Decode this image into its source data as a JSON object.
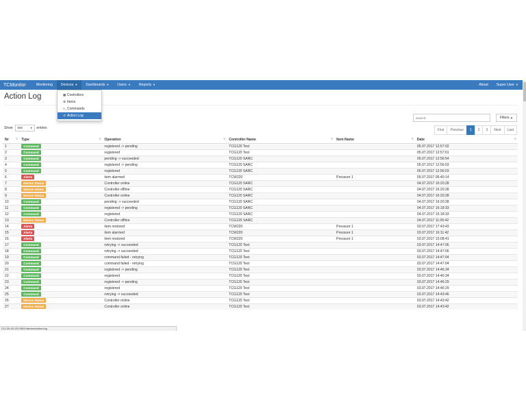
{
  "navbar": {
    "brand": "TCMonitor",
    "items": [
      {
        "label": "Monitoring",
        "caret": false
      },
      {
        "label": "Devices",
        "caret": true
      },
      {
        "label": "Dashboards",
        "caret": true
      },
      {
        "label": "Users",
        "caret": true
      },
      {
        "label": "Reports",
        "caret": true
      }
    ],
    "right": [
      {
        "label": "About",
        "caret": false
      },
      {
        "label": "Super User",
        "caret": true
      }
    ]
  },
  "devices_menu": [
    {
      "label": "Controllers",
      "icon": "controllers-icon",
      "glyph": "▦"
    },
    {
      "label": "Items",
      "icon": "gear-icon",
      "glyph": "⚙"
    },
    {
      "label": "Commands",
      "icon": "terminal-icon",
      "glyph": ">_"
    },
    {
      "label": "Action Log",
      "icon": "history-icon",
      "glyph": "↺"
    }
  ],
  "page": {
    "title": "Action Log"
  },
  "search": {
    "placeholder": "Search:"
  },
  "filters": {
    "label": "Filters"
  },
  "show": {
    "prefix": "Show",
    "value": "500",
    "suffix": "entries"
  },
  "pagination": [
    "First",
    "Previous",
    "1",
    "2",
    "3",
    "Next",
    "Last"
  ],
  "table": {
    "columns": [
      "Nr",
      "Type",
      "Operation",
      "Controller Name",
      "Item Name",
      "Date"
    ],
    "rows": [
      [
        "1",
        "Command",
        "registered -> pending",
        "TCG120 Test",
        "",
        "05.07.2017 12:57:02"
      ],
      [
        "2",
        "Command",
        "registered",
        "TCG120 Test",
        "",
        "05.07.2017 12:57:01"
      ],
      [
        "3",
        "Command",
        "pending -> succeeded",
        "TCG120 SARC",
        "",
        "05.07.2017 12:56:54"
      ],
      [
        "4",
        "Command",
        "registered -> pending",
        "TCG120 SARC",
        "",
        "05.07.2017 12:56:03"
      ],
      [
        "5",
        "Command",
        "registered",
        "TCG120 SARC",
        "",
        "05.07.2017 12:56:03"
      ],
      [
        "6",
        "Alerts",
        "item alarmed",
        "TCW220",
        "Pressure 1",
        "05.07.2017 06:40:14"
      ],
      [
        "7",
        "Device Status",
        "Controller online",
        "TCG120 SARC",
        "",
        "04.07.2017 16:20:28"
      ],
      [
        "8",
        "Device Status",
        "Controller offline",
        "TCG120 SARC",
        "",
        "04.07.2017 16:20:28"
      ],
      [
        "9",
        "Device Status",
        "Controller online",
        "TCG120 SARC",
        "",
        "04.07.2017 16:20:28"
      ],
      [
        "10",
        "Command",
        "pending -> succeeded",
        "TCG120 SARC",
        "",
        "04.07.2017 16:20:28"
      ],
      [
        "11",
        "Command",
        "registered -> pending",
        "TCG120 SARC",
        "",
        "04.07.2017 16:18:33"
      ],
      [
        "12",
        "Command",
        "registered",
        "TCG120 SARC",
        "",
        "04.07.2017 16:18:33"
      ],
      [
        "13",
        "Device Status",
        "Controller offline",
        "TCG120 SARC",
        "",
        "04.07.2017 11:05:42"
      ],
      [
        "14",
        "Alerts",
        "item restored",
        "TCW220",
        "Pressure 1",
        "03.07.2017 17:43:43"
      ],
      [
        "15",
        "Alerts",
        "item alarmed",
        "TCW220",
        "Pressure 1",
        "03.07.2017 16:11:42"
      ],
      [
        "16",
        "Alerts",
        "item restored",
        "TCW220",
        "Pressure 1",
        "03.07.2017 15:08:41"
      ],
      [
        "17",
        "Command",
        "retrying -> succeeded",
        "TCG120 Test",
        "",
        "03.07.2017 14:47:06"
      ],
      [
        "18",
        "Command",
        "retrying -> succeeded",
        "TCG120 Test",
        "",
        "03.07.2017 14:47:06"
      ],
      [
        "19",
        "Command",
        "command failed - retrying",
        "TCG120 Test",
        "",
        "03.07.2017 14:47:04"
      ],
      [
        "20",
        "Command",
        "command failed - retrying",
        "TCG120 Test",
        "",
        "03.07.2017 14:47:04"
      ],
      [
        "21",
        "Command",
        "registered -> pending",
        "TCG120 Test",
        "",
        "03.07.2017 14:46:34"
      ],
      [
        "22",
        "Command",
        "registered",
        "TCG120 Test",
        "",
        "03.07.2017 14:46:34"
      ],
      [
        "23",
        "Command",
        "registered -> pending",
        "TCG120 Test",
        "",
        "03.07.2017 14:46:29"
      ],
      [
        "24",
        "Command",
        "registered",
        "TCG120 Test",
        "",
        "03.07.2017 14:46:29"
      ],
      [
        "25",
        "Command",
        "retrying -> succeeded",
        "TCG120 Test",
        "",
        "03.07.2017 14:43:46"
      ],
      [
        "26",
        "Device Status",
        "Controller online",
        "TCG120 Test",
        "",
        "03.07.2017 14:43:42"
      ],
      [
        "27",
        "Device Status",
        "Controller online",
        "TCG120 Test",
        "",
        "03.07.2017 14:43:42"
      ]
    ]
  },
  "status_url": "212.25.45.120:3001/device/action-log",
  "colors": {
    "navbar": "#3a7bc0",
    "command": "#5cb85c",
    "alerts": "#d9534f",
    "device_status": "#f0ad4e",
    "pager_active": "#337ab7"
  }
}
